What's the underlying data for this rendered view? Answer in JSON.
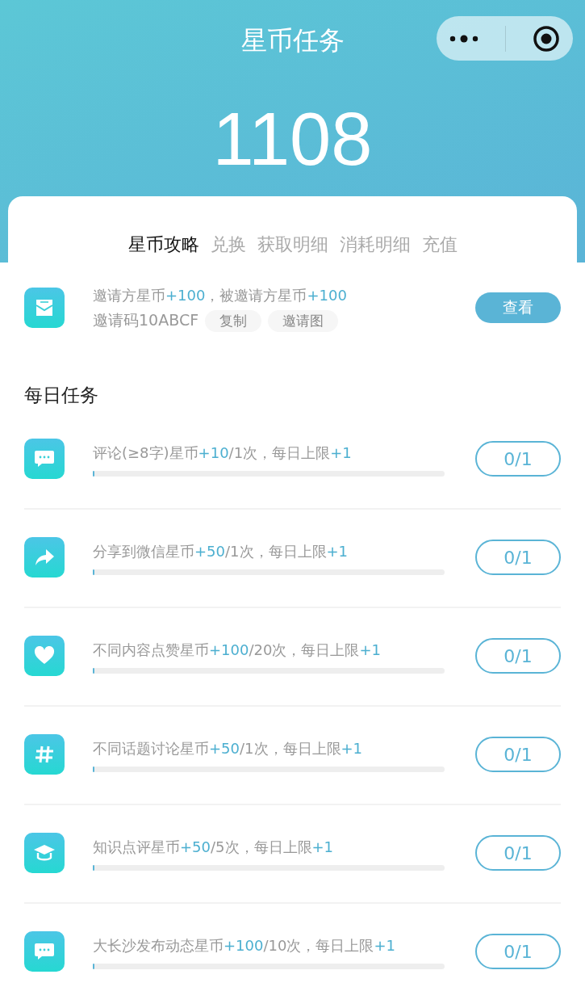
{
  "title": "星币任务",
  "balance": "1108",
  "tabs": [
    {
      "label": "星币攻略",
      "selected": true
    },
    {
      "label": "兑换",
      "selected": false
    },
    {
      "label": "获取明细",
      "selected": false
    },
    {
      "label": "消耗明细",
      "selected": false
    },
    {
      "label": "充值",
      "selected": false
    }
  ],
  "invite": {
    "parts": [
      {
        "text": "邀请方星币",
        "accent": false
      },
      {
        "text": "+100",
        "accent": true
      },
      {
        "text": "，被邀请方星币",
        "accent": false
      },
      {
        "text": "+100",
        "accent": true
      }
    ],
    "code": "邀请码10ABCF",
    "chips": [
      "复制",
      "邀请图"
    ],
    "button": "查看"
  },
  "section_title": "每日任务",
  "tasks": [
    {
      "parts": [
        {
          "text": "评论(≥8字)星币",
          "accent": false
        },
        {
          "text": "+10",
          "accent": true
        },
        {
          "text": "/1次，每日上限",
          "accent": false
        },
        {
          "text": "+1",
          "accent": true
        }
      ],
      "level": 0,
      "count": "0/1"
    },
    {
      "parts": [
        {
          "text": "分享到微信星币",
          "accent": false
        },
        {
          "text": "+50",
          "accent": true
        },
        {
          "text": "/1次，每日上限",
          "accent": false
        },
        {
          "text": "+1",
          "accent": true
        }
      ],
      "level": 0,
      "count": "0/1"
    },
    {
      "parts": [
        {
          "text": "不同内容点赞星币",
          "accent": false
        },
        {
          "text": "+100",
          "accent": true
        },
        {
          "text": "/20次，每日上限",
          "accent": false
        },
        {
          "text": "+1",
          "accent": true
        }
      ],
      "level": 0,
      "count": "0/1"
    },
    {
      "parts": [
        {
          "text": "不同话题讨论星币",
          "accent": false
        },
        {
          "text": "+50",
          "accent": true
        },
        {
          "text": "/1次，每日上限",
          "accent": false
        },
        {
          "text": "+1",
          "accent": true
        }
      ],
      "level": 0,
      "count": "0/1"
    },
    {
      "parts": [
        {
          "text": "知识点评星币",
          "accent": false
        },
        {
          "text": "+50",
          "accent": true
        },
        {
          "text": "/5次，每日上限",
          "accent": false
        },
        {
          "text": "+1",
          "accent": true
        }
      ],
      "level": 0,
      "count": "0/1"
    },
    {
      "parts": [
        {
          "text": "大长沙发布动态星币",
          "accent": false
        },
        {
          "text": "+100",
          "accent": true
        },
        {
          "text": "/10次，每日上限",
          "accent": false
        },
        {
          "text": "+1",
          "accent": true
        }
      ],
      "level": 0,
      "count": "0/1"
    }
  ]
}
